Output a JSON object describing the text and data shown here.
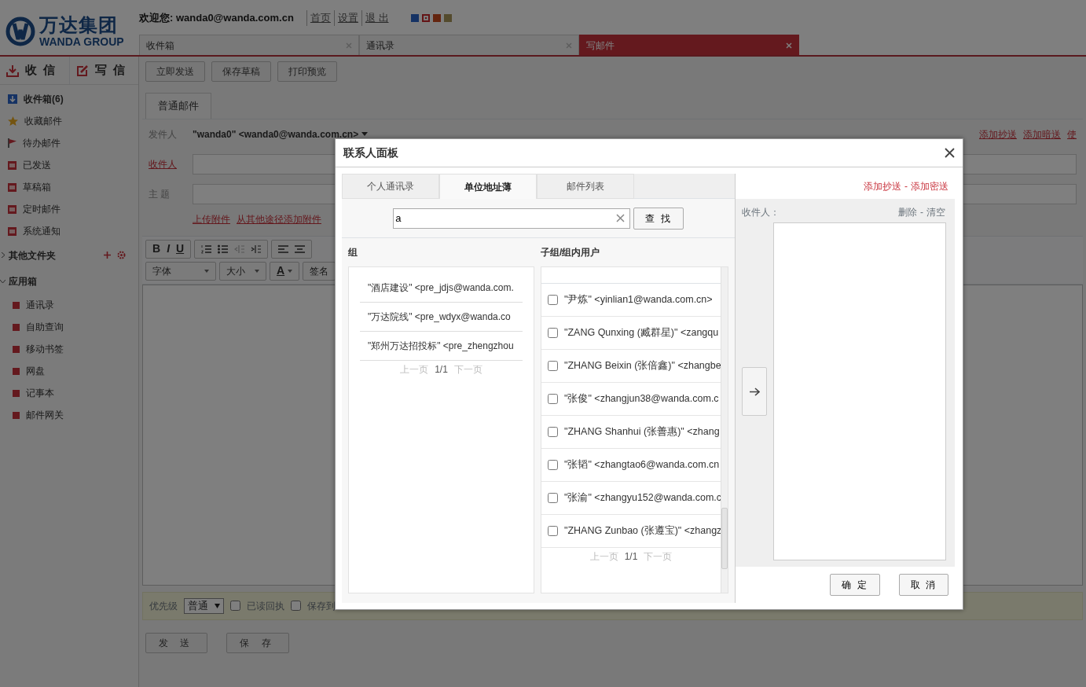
{
  "header": {
    "logo_cn": "万达集团",
    "logo_en": "WANDA GROUP",
    "welcome": "欢迎您: wanda0@wanda.com.cn",
    "links": [
      "首页",
      "设置",
      "退 出"
    ],
    "swatches": [
      {
        "color": "#153264",
        "selected": false
      },
      {
        "color": "#641416",
        "selected": true
      },
      {
        "color": "#64250f",
        "selected": false
      },
      {
        "color": "#544b2d",
        "selected": false
      }
    ]
  },
  "tabs": [
    {
      "label": "收件箱",
      "selected": false
    },
    {
      "label": "通讯录",
      "selected": false
    },
    {
      "label": "写邮件",
      "selected": true
    }
  ],
  "sidebar": {
    "receive": "收 信",
    "write": "写 信",
    "folders": [
      {
        "label": "收件箱(6)",
        "kind": "inbox",
        "unread": true
      },
      {
        "label": "收藏邮件",
        "kind": "star",
        "unread": false
      },
      {
        "label": "待办邮件",
        "kind": "flag",
        "unread": false
      },
      {
        "label": "已发送",
        "kind": "folder",
        "unread": false
      },
      {
        "label": "草稿箱",
        "kind": "folder",
        "unread": false
      },
      {
        "label": "定时邮件",
        "kind": "folder",
        "unread": false
      },
      {
        "label": "系统通知",
        "kind": "folder",
        "unread": false
      }
    ],
    "other_folders": {
      "label": "其他文件夹",
      "expanded": false
    },
    "apps": {
      "label": "应用箱",
      "expanded": true,
      "items": [
        "通讯录",
        "自助查询",
        "移动书签",
        "网盘",
        "记事本",
        "邮件网关"
      ]
    }
  },
  "compose": {
    "toolbar": [
      "立即发送",
      "保存草稿",
      "打印预览"
    ],
    "mode_tab": "普通邮件",
    "from_label": "发件人",
    "from_value": "\"wanda0\" <wanda0@wanda.com.cn>",
    "to_label": "收件人",
    "subject_label": "主 题",
    "attach_links": [
      "上传附件",
      "从其他途径添加附件"
    ],
    "cc_links": [
      "添加抄送",
      "添加暗送",
      "使"
    ],
    "editor": {
      "format_buttons": [
        "B",
        "I",
        "U"
      ],
      "font": "字体",
      "size": "大小",
      "color_button": "A",
      "signature": "签名"
    },
    "options": {
      "priority_label": "优先级",
      "priority": "普通",
      "checks": [
        {
          "label": "已读回执",
          "checked": false
        },
        {
          "label": "保存到",
          "checked": false
        }
      ]
    },
    "buttons": [
      "发 送",
      "保 存"
    ]
  },
  "dialog": {
    "title": "联系人面板",
    "tabs": [
      {
        "label": "个人通讯录",
        "selected": false
      },
      {
        "label": "单位地址薄",
        "selected": true
      },
      {
        "label": "邮件列表",
        "selected": false
      }
    ],
    "search": {
      "value": "a",
      "button": "查 找"
    },
    "groups_header": "组",
    "groups": [
      "\"酒店建设\" <pre_jdjs@wanda.com.",
      "\"万达院线\" <pre_wdyx@wanda.co",
      "\"郑州万达招投标\" <pre_zhengzhou"
    ],
    "groups_pager": {
      "prev": "上一页",
      "page": "1/1",
      "next": "下一页"
    },
    "users_header": "子组/组内用户",
    "users": [
      {
        "label": "\"尹炼\" <yinlian1@wanda.com.cn>",
        "checked": false
      },
      {
        "label": "\"ZANG Qunxing (臧群星)\" <zangqu",
        "checked": false
      },
      {
        "label": "\"ZHANG Beixin (张倍鑫)\" <zhangbe",
        "checked": false
      },
      {
        "label": "\"张俊\" <zhangjun38@wanda.com.c",
        "checked": false
      },
      {
        "label": "\"ZHANG Shanhui (张善惠)\" <zhang",
        "checked": false
      },
      {
        "label": "\"张韬\" <zhangtao6@wanda.com.cn",
        "checked": false
      },
      {
        "label": "\"张渝\" <zhangyu152@wanda.com.c",
        "checked": false
      },
      {
        "label": "\"ZHANG Zunbao (张遵宝)\" <zhangz",
        "checked": false
      }
    ],
    "users_pager": {
      "prev": "上一页",
      "page": "1/1",
      "next": "下一页"
    },
    "add_links": [
      "添加抄送",
      "添加密送"
    ],
    "add_separator": "-",
    "recipients_label": "收件人：",
    "delete": "删除",
    "clear_separator": "-",
    "clear": "清空",
    "buttons": [
      "确 定",
      "取 消"
    ]
  }
}
